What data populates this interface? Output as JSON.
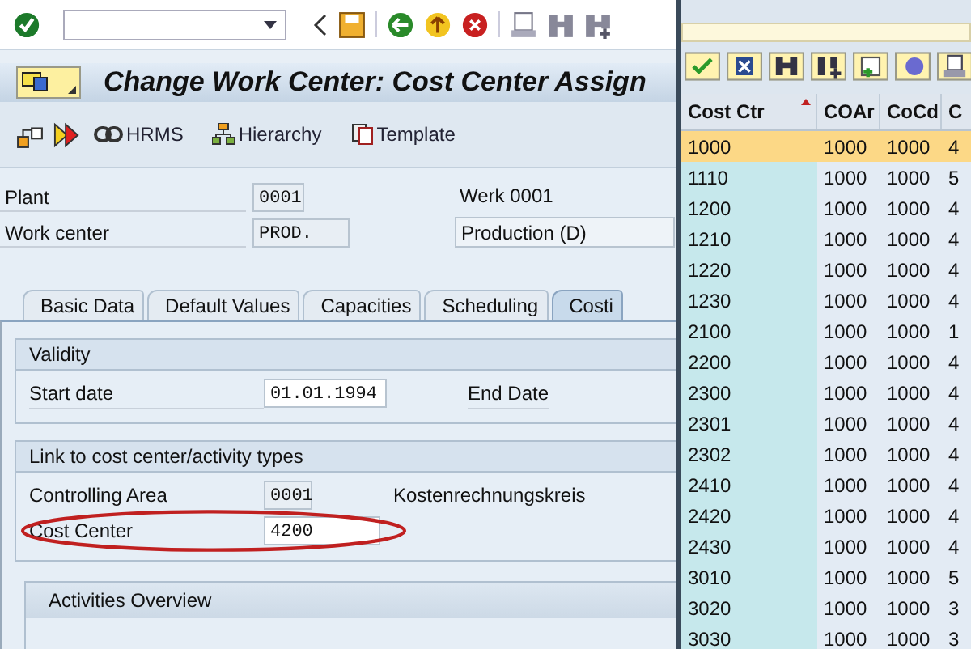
{
  "window": {
    "title": "Change Work Center: Cost Center Assign"
  },
  "app_toolbar": [
    {
      "label": "HRMS"
    },
    {
      "label": "Hierarchy"
    },
    {
      "label": "Template"
    }
  ],
  "header_fields": [
    {
      "label": "Plant",
      "value": "0001",
      "description": "Werk 0001",
      "kind": "text"
    },
    {
      "label": "Work center",
      "value": "PROD.",
      "description": "Production (D)",
      "kind": "box"
    }
  ],
  "tabs": [
    {
      "label": "Basic Data",
      "selected": false
    },
    {
      "label": "Default Values",
      "selected": false
    },
    {
      "label": "Capacities",
      "selected": false
    },
    {
      "label": "Scheduling",
      "selected": false
    },
    {
      "label": "Costi",
      "selected": true
    }
  ],
  "validity": {
    "title": "Validity",
    "start_date": {
      "label": "Start date",
      "value": "01.01.1994"
    },
    "end_date": {
      "label": "End Date"
    }
  },
  "link": {
    "title": "Link to cost center/activity types",
    "controlling_area": {
      "label": "Controlling Area",
      "value": "0001",
      "description": "Kostenrechnungskreis"
    },
    "cost_center": {
      "label": "Cost Center",
      "value": "4200",
      "highlighted": true
    }
  },
  "activities": {
    "title": "Activities Overview"
  },
  "popup": {
    "columns": [
      "Cost Ctr",
      "COAr",
      "CoCd",
      "C"
    ],
    "rows": [
      {
        "cells": [
          "1000",
          "1000",
          "1000",
          "4"
        ],
        "selected": true
      },
      {
        "cells": [
          "1110",
          "1000",
          "1000",
          "5"
        ],
        "selected": false
      },
      {
        "cells": [
          "1200",
          "1000",
          "1000",
          "4"
        ],
        "selected": false
      },
      {
        "cells": [
          "1210",
          "1000",
          "1000",
          "4"
        ],
        "selected": false
      },
      {
        "cells": [
          "1220",
          "1000",
          "1000",
          "4"
        ],
        "selected": false
      },
      {
        "cells": [
          "1230",
          "1000",
          "1000",
          "4"
        ],
        "selected": false
      },
      {
        "cells": [
          "2100",
          "1000",
          "1000",
          "1"
        ],
        "selected": false
      },
      {
        "cells": [
          "2200",
          "1000",
          "1000",
          "4"
        ],
        "selected": false
      },
      {
        "cells": [
          "2300",
          "1000",
          "1000",
          "4"
        ],
        "selected": false
      },
      {
        "cells": [
          "2301",
          "1000",
          "1000",
          "4"
        ],
        "selected": false
      },
      {
        "cells": [
          "2302",
          "1000",
          "1000",
          "4"
        ],
        "selected": false
      },
      {
        "cells": [
          "2410",
          "1000",
          "1000",
          "4"
        ],
        "selected": false
      },
      {
        "cells": [
          "2420",
          "1000",
          "1000",
          "4"
        ],
        "selected": false
      },
      {
        "cells": [
          "2430",
          "1000",
          "1000",
          "4"
        ],
        "selected": false
      },
      {
        "cells": [
          "3010",
          "1000",
          "1000",
          "5"
        ],
        "selected": false
      },
      {
        "cells": [
          "3020",
          "1000",
          "1000",
          "3"
        ],
        "selected": false
      },
      {
        "cells": [
          "3030",
          "1000",
          "1000",
          "3"
        ],
        "selected": false
      }
    ]
  }
}
